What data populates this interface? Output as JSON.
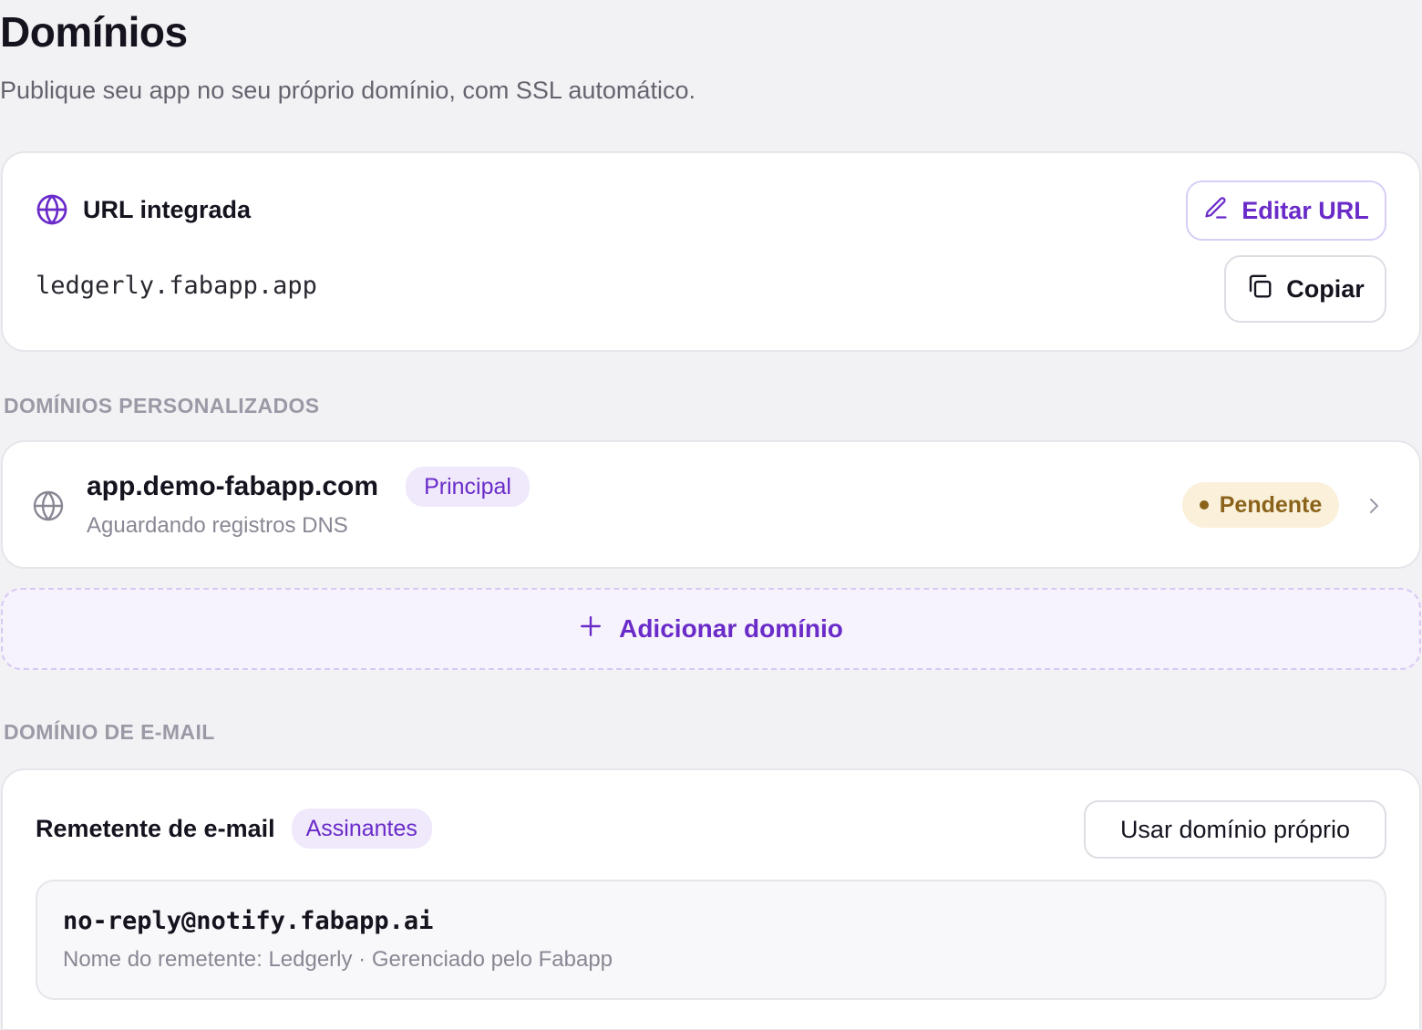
{
  "page": {
    "title": "Domínios",
    "subtitle": "Publique seu app no seu próprio domínio, com SSL automático."
  },
  "builtin_url": {
    "label": "URL integrada",
    "value": "ledgerly.fabapp.app",
    "edit_button": "Editar URL",
    "copy_button": "Copiar",
    "icons": {
      "header": "globe-icon",
      "edit": "pencil-icon",
      "copy": "copy-icon"
    }
  },
  "custom_domains": {
    "section_label": "DOMÍNIOS PERSONALIZADOS",
    "items": [
      {
        "domain": "app.demo-fabapp.com",
        "badge": "Principal",
        "status_text": "Aguardando registros DNS",
        "status_badge": "Pendente"
      }
    ],
    "add_button": "Adicionar domínio"
  },
  "email_domain": {
    "section_label": "DOMÍNIO DE E-MAIL",
    "label": "Remetente de e-mail",
    "badge": "Assinantes",
    "own_domain_button": "Usar domínio próprio",
    "sender_address": "no-reply@notify.fabapp.ai",
    "sender_meta": "Nome do remetente: Ledgerly · Gerenciado pelo Fabapp"
  },
  "colors": {
    "accent": "#6a2bc9",
    "accent_soft": "#efe9fb",
    "pending_bg": "#fbf0d9",
    "pending_text": "#8a621a",
    "background": "#f2f2f4"
  }
}
